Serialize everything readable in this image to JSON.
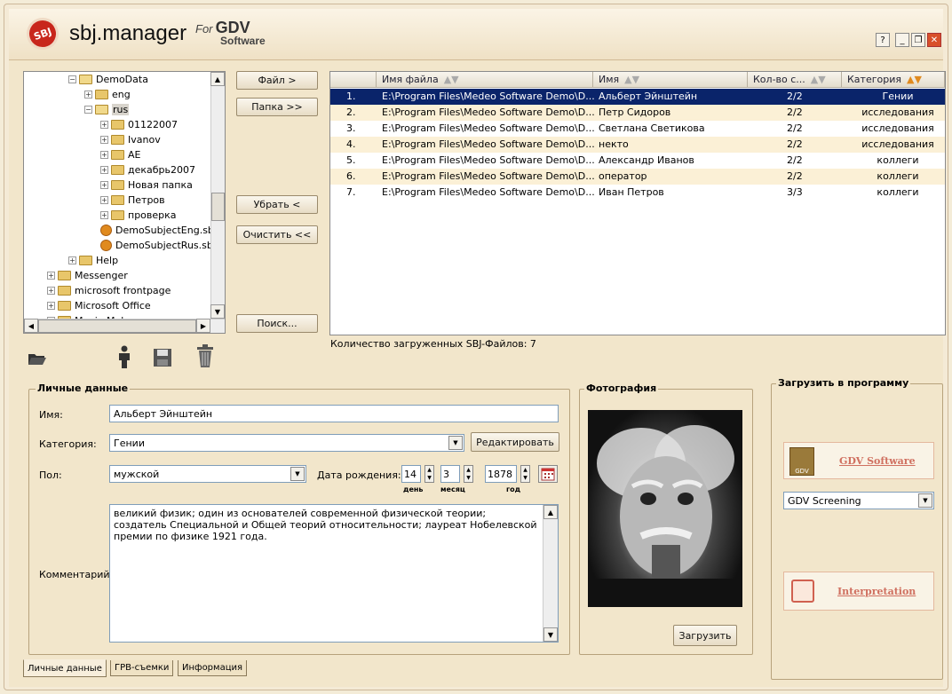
{
  "window": {
    "app_name": "sbj.manager",
    "brand_for": "For",
    "brand_gdv": "GDV",
    "brand_software": "Software",
    "logo_text": "SBJ",
    "controls": {
      "help": "?",
      "minimize": "_",
      "restore": "❐",
      "close": "✕"
    }
  },
  "tree": {
    "items": [
      {
        "label": "DemoData",
        "expander": "−",
        "kind": "folder-open"
      },
      {
        "label": "eng",
        "expander": "+",
        "kind": "folder"
      },
      {
        "label": "rus",
        "expander": "−",
        "kind": "folder-open",
        "selected": true
      },
      {
        "label": "01122007",
        "expander": "+",
        "kind": "folder"
      },
      {
        "label": "Ivanov",
        "expander": "+",
        "kind": "folder"
      },
      {
        "label": "AE",
        "expander": "+",
        "kind": "folder"
      },
      {
        "label": "декабрь2007",
        "expander": "+",
        "kind": "folder"
      },
      {
        "label": "Новая папка",
        "expander": "+",
        "kind": "folder"
      },
      {
        "label": "Петров",
        "expander": "+",
        "kind": "folder"
      },
      {
        "label": "проверка",
        "expander": "+",
        "kind": "folder"
      },
      {
        "label": "DemoSubjectEng.sbj",
        "expander": "",
        "kind": "sbj"
      },
      {
        "label": "DemoSubjectRus.sbj",
        "expander": "",
        "kind": "sbj"
      },
      {
        "label": "Help",
        "expander": "+",
        "kind": "folder"
      },
      {
        "label": "Messenger",
        "expander": "+",
        "kind": "folder"
      },
      {
        "label": "microsoft frontpage",
        "expander": "+",
        "kind": "folder"
      },
      {
        "label": "Microsoft Office",
        "expander": "+",
        "kind": "folder"
      },
      {
        "label": "Movie Maker",
        "expander": "+",
        "kind": "folder"
      }
    ]
  },
  "buttons": {
    "file": "Файл >",
    "folder": "Папка >>",
    "remove": "Убрать <",
    "clear": "Очистить <<",
    "search": "Поиск...",
    "edit": "Редактировать",
    "upload_photo": "Загрузить"
  },
  "grid": {
    "columns": [
      "",
      "Имя файла",
      "Имя",
      "Кол-во с...",
      "Категория"
    ],
    "rows": [
      {
        "num": "1.",
        "file": "E:\\Program Files\\Medeo Software Demo\\D...",
        "name": "Альберт Эйнштейн",
        "count": "2/2",
        "category": "Гении"
      },
      {
        "num": "2.",
        "file": "E:\\Program Files\\Medeo Software Demo\\D...",
        "name": "Петр Сидоров",
        "count": "2/2",
        "category": "исследования"
      },
      {
        "num": "3.",
        "file": "E:\\Program Files\\Medeo Software Demo\\D...",
        "name": "Светлана Светикова",
        "count": "2/2",
        "category": "исследования"
      },
      {
        "num": "4.",
        "file": "E:\\Program Files\\Medeo Software Demo\\D...",
        "name": "некто",
        "count": "2/2",
        "category": "исследования"
      },
      {
        "num": "5.",
        "file": "E:\\Program Files\\Medeo Software Demo\\D...",
        "name": "Александр Иванов",
        "count": "2/2",
        "category": "коллеги"
      },
      {
        "num": "6.",
        "file": "E:\\Program Files\\Medeo Software Demo\\D...",
        "name": "оператор",
        "count": "2/2",
        "category": "коллеги"
      },
      {
        "num": "7.",
        "file": "E:\\Program Files\\Medeo Software Demo\\D...",
        "name": "Иван Петров",
        "count": "3/3",
        "category": "коллеги"
      }
    ]
  },
  "status_text": "Количество загруженных SBJ-Файлов: 7",
  "personal": {
    "group_title": "Личные данные",
    "name_label": "Имя:",
    "name_value": "Альберт Эйнштейн",
    "category_label": "Категория:",
    "category_value": "Гении",
    "gender_label": "Пол:",
    "gender_value": "мужской",
    "birth_label": "Дата рождения:",
    "day": "14",
    "month": "3",
    "year": "1878",
    "day_caption": "день",
    "month_caption": "месяц",
    "year_caption": "год",
    "comment_label": "Комментарий",
    "comment": "великий физик; один из основателей современной физической теории; создатель Специальной и Общей теорий относительности; лауреат Нобелевской премии по физике 1921 года."
  },
  "photo": {
    "group_title": "Фотография"
  },
  "load": {
    "group_title": "Загрузить в программу",
    "gdv_label": "GDV Software",
    "gdv_icon_text": "GDV",
    "select_value": "GDV Screening",
    "interp_label": "Interpretation"
  },
  "tabs": [
    "Личные данные",
    "ГРВ-съемки",
    "Информация"
  ]
}
